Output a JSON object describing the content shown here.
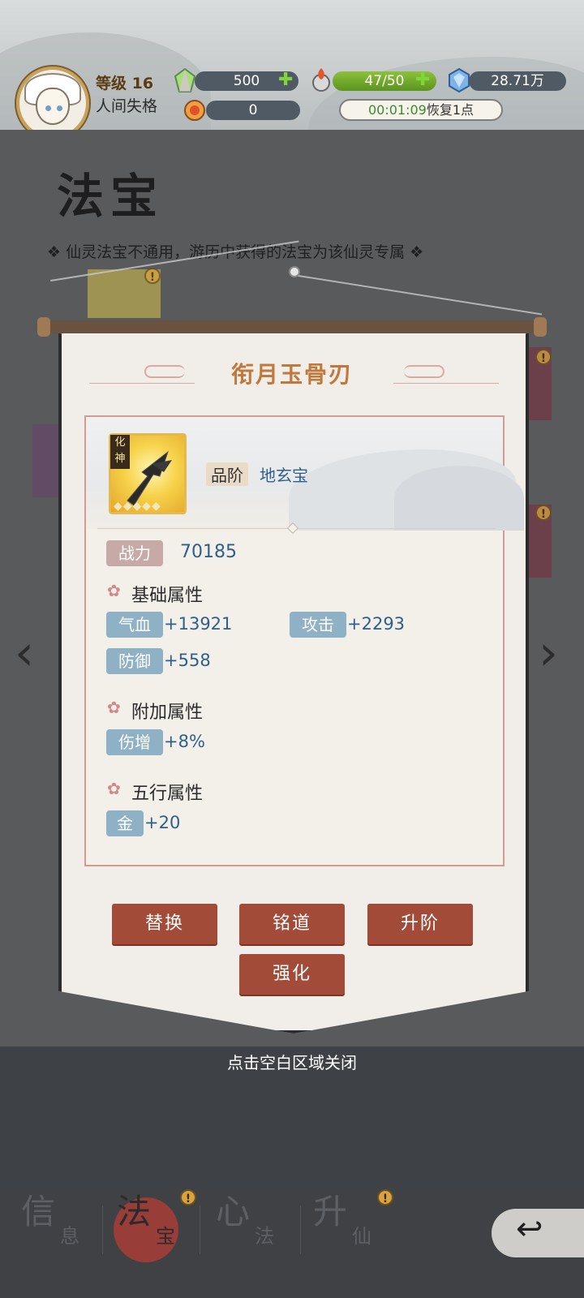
{
  "header": {
    "level_label": "等级 16",
    "player_title": "人间失格",
    "jade": {
      "icon": "jade-crystal-icon",
      "value": "500"
    },
    "stamina": {
      "icon": "flame-gourd-icon",
      "value": "47/50",
      "accent": "#6fa82e"
    },
    "diamond": {
      "icon": "blue-crystal-icon",
      "value": "28.71万"
    },
    "orb": {
      "icon": "fire-orb-icon",
      "value": "0"
    },
    "recover_timer": "00:01:09",
    "recover_text": "恢复1点"
  },
  "page": {
    "title": "法宝",
    "hint": "仙灵法宝不通用，游历中获得的法宝为该仙灵专属"
  },
  "item": {
    "name": "衔月玉骨刃",
    "tag": "化神",
    "stars": "◆◆◆◆◆",
    "tier_label": "品阶",
    "tier_value": "地玄宝",
    "power_label": "战力",
    "power_value": "70185",
    "sections": {
      "base": {
        "title": "基础属性",
        "attrs": [
          {
            "label": "气血",
            "value": "+13921"
          },
          {
            "label": "攻击",
            "value": "+2293"
          },
          {
            "label": "防御",
            "value": "+558"
          }
        ]
      },
      "extra": {
        "title": "附加属性",
        "attrs": [
          {
            "label": "伤增",
            "value": "+8%"
          }
        ]
      },
      "elements": {
        "title": "五行属性",
        "attrs": [
          {
            "label": "金",
            "value": "+20"
          }
        ]
      }
    }
  },
  "buttons": {
    "replace": "替换",
    "inscribe": "铭道",
    "ascend": "升阶",
    "strengthen": "强化"
  },
  "close_hint": "点击空白区域关闭",
  "tabs": [
    {
      "big": "信",
      "small": "息"
    },
    {
      "big": "法",
      "small": "宝"
    },
    {
      "big": "心",
      "small": "法"
    },
    {
      "big": "升",
      "small": "仙"
    }
  ],
  "badge": "!",
  "colors": {
    "button": "#a24b38",
    "item_name": "#c0783b",
    "value_blue": "#2f6089"
  }
}
